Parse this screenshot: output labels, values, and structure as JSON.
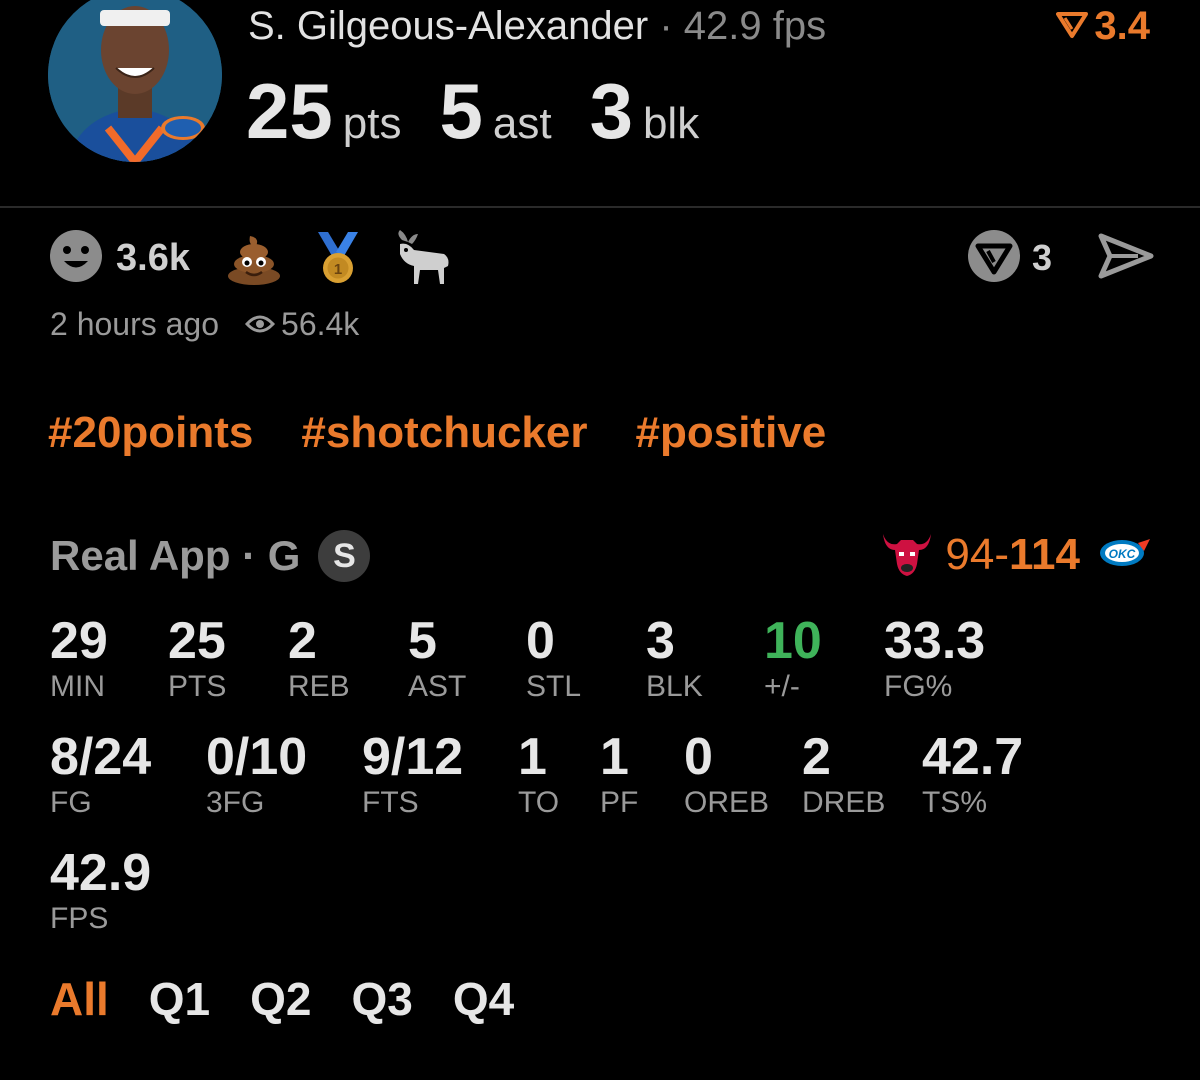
{
  "player": {
    "name": "S. Gilgeous-Alexander",
    "separator": "·",
    "fps_text": "42.9 fps",
    "rating": "3.4"
  },
  "headline": [
    {
      "value": "25",
      "unit": "pts"
    },
    {
      "value": "5",
      "unit": "ast"
    },
    {
      "value": "3",
      "unit": "blk"
    }
  ],
  "reactions": {
    "smile_count": "3.6k",
    "comment_count": "3",
    "icons": [
      "smile-icon",
      "poop-emoji",
      "medal-emoji",
      "goat-emoji",
      "comment-icon",
      "share-icon"
    ]
  },
  "meta": {
    "time_ago": "2 hours ago",
    "views": "56.4k"
  },
  "tags": [
    "#20points",
    "#shotchucker",
    "#positive"
  ],
  "game": {
    "source": "Real App · G",
    "badge": "S",
    "score_away": "94",
    "score_sep": "-",
    "score_home": "114"
  },
  "stats": {
    "row1": [
      {
        "value": "29",
        "label": "MIN"
      },
      {
        "value": "25",
        "label": "PTS"
      },
      {
        "value": "2",
        "label": "REB"
      },
      {
        "value": "5",
        "label": "AST"
      },
      {
        "value": "0",
        "label": "STL"
      },
      {
        "value": "3",
        "label": "BLK"
      },
      {
        "value": "10",
        "label": "+/-"
      },
      {
        "value": "33.3",
        "label": "FG%"
      }
    ],
    "row2": [
      {
        "value": "8/24",
        "label": "FG"
      },
      {
        "value": "0/10",
        "label": "3FG"
      },
      {
        "value": "9/12",
        "label": "FTS"
      },
      {
        "value": "1",
        "label": "TO"
      },
      {
        "value": "1",
        "label": "PF"
      },
      {
        "value": "0",
        "label": "OREB"
      },
      {
        "value": "2",
        "label": "DREB"
      },
      {
        "value": "42.7",
        "label": "TS%"
      }
    ],
    "row3": [
      {
        "value": "42.9",
        "label": "FPS"
      }
    ]
  },
  "quarters": [
    "All",
    "Q1",
    "Q2",
    "Q3",
    "Q4"
  ],
  "colors": {
    "accent": "#ea7a2c",
    "positive": "#3fb35a",
    "background": "#000000"
  }
}
